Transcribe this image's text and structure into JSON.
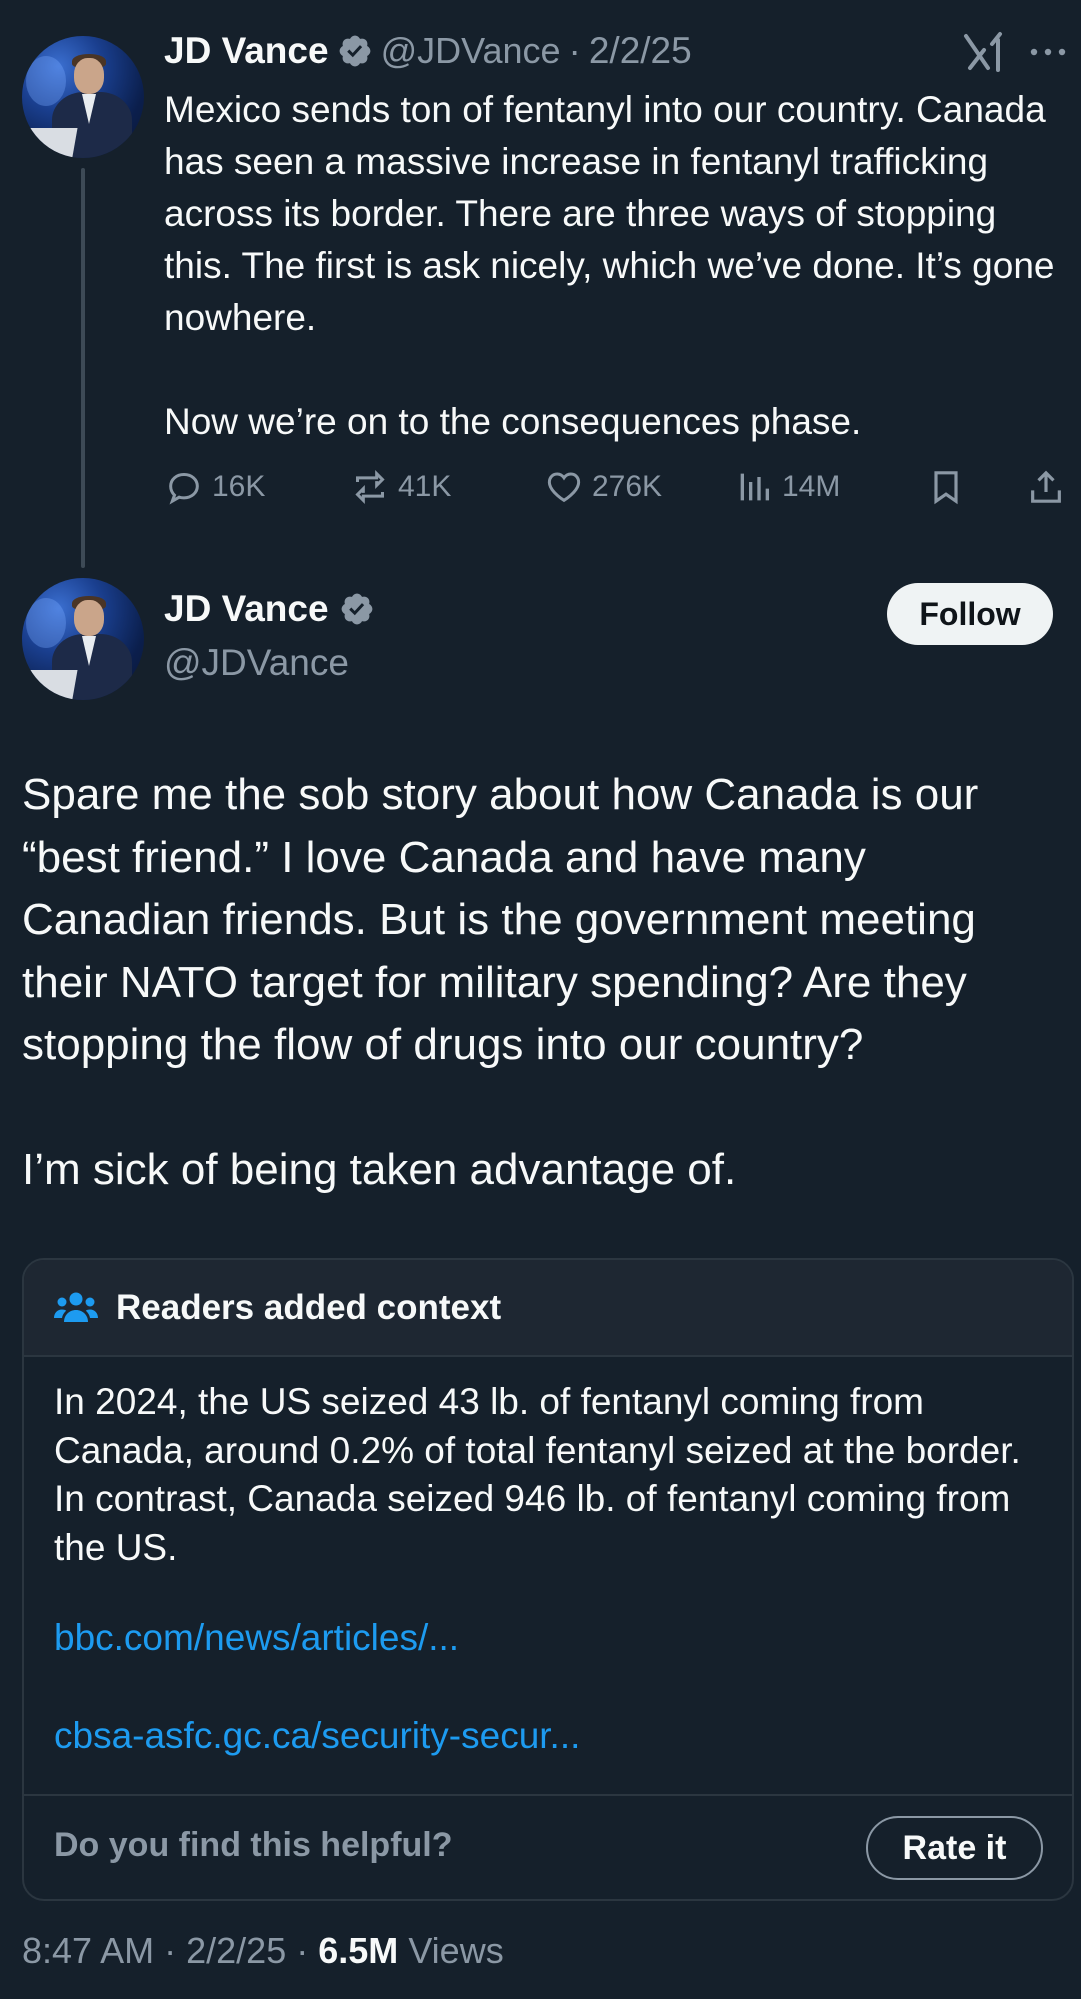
{
  "quoted_tweet": {
    "author_name": "JD Vance",
    "handle": "@JDVance",
    "separator": "·",
    "date": "2/2/25",
    "text_paragraphs": [
      "Mexico sends ton of fentanyl into our country. Canada has seen a massive increase in fentanyl trafficking across its border. There are three ways of stopping this. The first is ask nicely, which we’ve done. It’s gone nowhere.",
      "Now we’re on to the consequences phase."
    ],
    "replies": "16K",
    "reposts": "41K",
    "likes": "276K",
    "views": "14M"
  },
  "main_tweet": {
    "author_name": "JD Vance",
    "handle": "@JDVance",
    "follow_label": "Follow",
    "text_paragraphs": [
      "Spare me the sob story about how Canada is our “best friend.” I love Canada and have many Canadian friends. But is the government meeting their NATO target for military spending? Are they stopping the flow of drugs into our country?",
      "I’m sick of being taken advantage of."
    ]
  },
  "community_note": {
    "title": "Readers added context",
    "body": "In 2024, the US seized 43 lb. of fentanyl coming from Canada, around 0.2% of total fentanyl seized at the border. In contrast, Canada seized 946 lb. of fentanyl coming from the US.",
    "links": [
      "bbc.com/news/articles/...",
      "cbsa-asfc.gc.ca/security-secur..."
    ],
    "helpful_question": "Do you find this helpful?",
    "rate_label": "Rate it"
  },
  "footer": {
    "time": "8:47 AM",
    "separator": "·",
    "date": "2/2/25",
    "views_count": "6.5M",
    "views_label": "Views"
  },
  "colors": {
    "background": "#15202b",
    "text": "#f7f9f9",
    "muted": "#8b98a5",
    "link": "#1d9bf0",
    "verified_badge": "#8b98a5",
    "note_header": "#1e2732"
  }
}
